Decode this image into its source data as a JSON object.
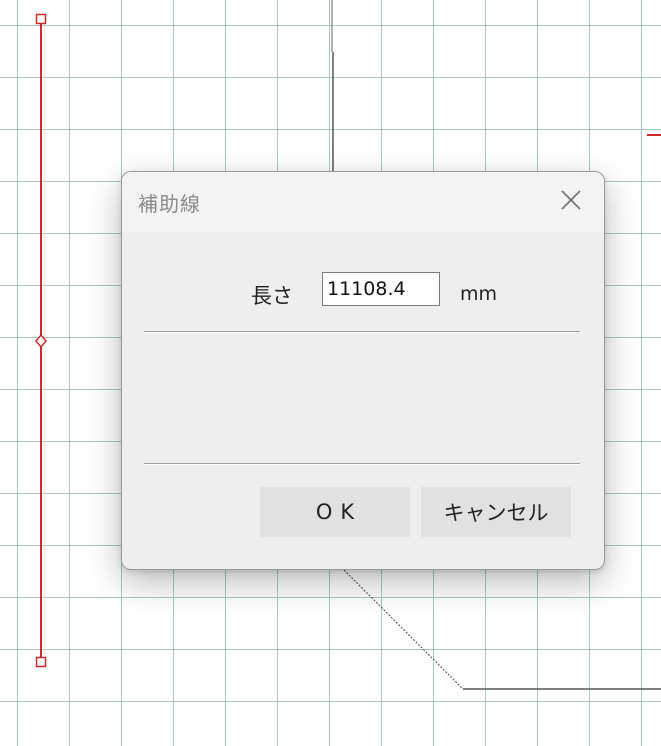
{
  "dialog": {
    "title": "補助線",
    "length_label": "長さ",
    "length_value": "11108.4",
    "unit": "mm",
    "ok_label": "OK",
    "cancel_label": "キャンセル"
  },
  "colors": {
    "grid": "#a9c9bf",
    "guide_line": "#cc2a2a",
    "drawing_line": "#555555",
    "dialog_bg": "#eeeeee"
  },
  "icons": {
    "close": "close-icon"
  }
}
